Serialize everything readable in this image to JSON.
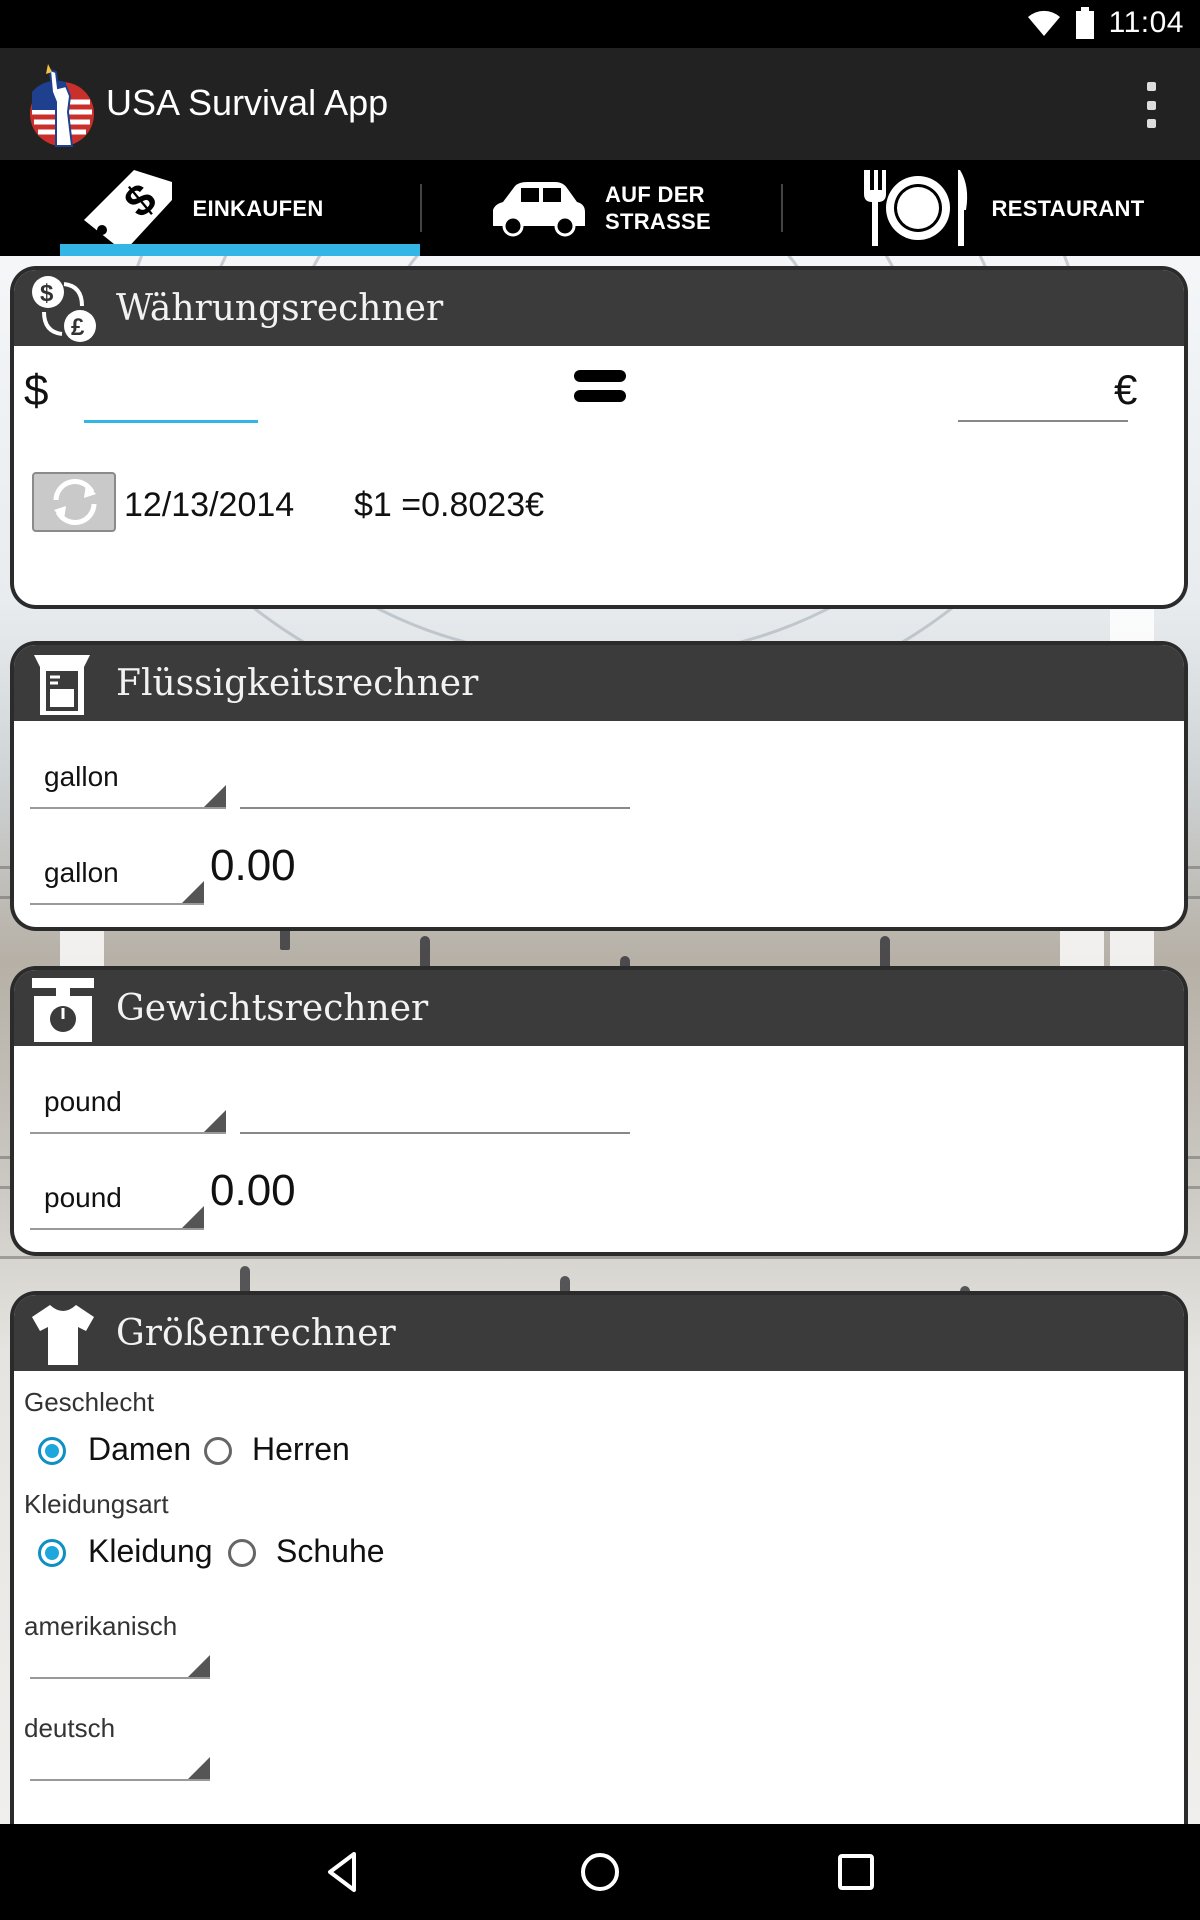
{
  "status_bar": {
    "time": "11:04",
    "icons": [
      "wifi-icon",
      "battery-icon"
    ]
  },
  "action_bar": {
    "title": "USA Survival App",
    "logo": "statue-of-liberty-logo",
    "menu_icon": "overflow-menu-icon"
  },
  "tabs": [
    {
      "label_lines": [
        "EINKAUFEN"
      ],
      "icon": "price-tag-icon",
      "selected": true
    },
    {
      "label_lines": [
        "AUF DER",
        "STRASSE"
      ],
      "icon": "car-icon",
      "selected": false
    },
    {
      "label_lines": [
        "RESTAURANT"
      ],
      "icon": "plate-cutlery-icon",
      "selected": false
    }
  ],
  "currency": {
    "title": "Währungsrechner",
    "icon": "currency-exchange-icon",
    "from_symbol": "$",
    "to_symbol": "€",
    "from_value": "",
    "to_value": "",
    "equals_icon": "equals-icon",
    "refresh_icon": "refresh-icon",
    "date": "12/13/2014",
    "rate": "$1 =0.8023€"
  },
  "liquid": {
    "title": "Flüssigkeitsrechner",
    "icon": "measuring-jug-icon",
    "from_unit": "gallon",
    "input_value": "",
    "to_unit": "gallon",
    "result": "0.00"
  },
  "weight": {
    "title": "Gewichtsrechner",
    "icon": "scale-icon",
    "from_unit": "pound",
    "input_value": "",
    "to_unit": "pound",
    "result": "0.00"
  },
  "size": {
    "title": "Größenrechner",
    "icon": "tshirt-icon",
    "gender_label": "Geschlecht",
    "gender_options": [
      "Damen",
      "Herren"
    ],
    "gender_selected": "Damen",
    "type_label": "Kleidungsart",
    "type_options": [
      "Kleidung",
      "Schuhe"
    ],
    "type_selected": "Kleidung",
    "us_label": "amerikanisch",
    "us_value": "",
    "de_label": "deutsch",
    "de_value": ""
  },
  "nav_bar": {
    "icons": [
      "back-icon",
      "home-icon",
      "recents-icon"
    ]
  },
  "colors": {
    "accent": "#33b5e5",
    "header": "#3b3b3b",
    "action_bar": "#222222"
  }
}
